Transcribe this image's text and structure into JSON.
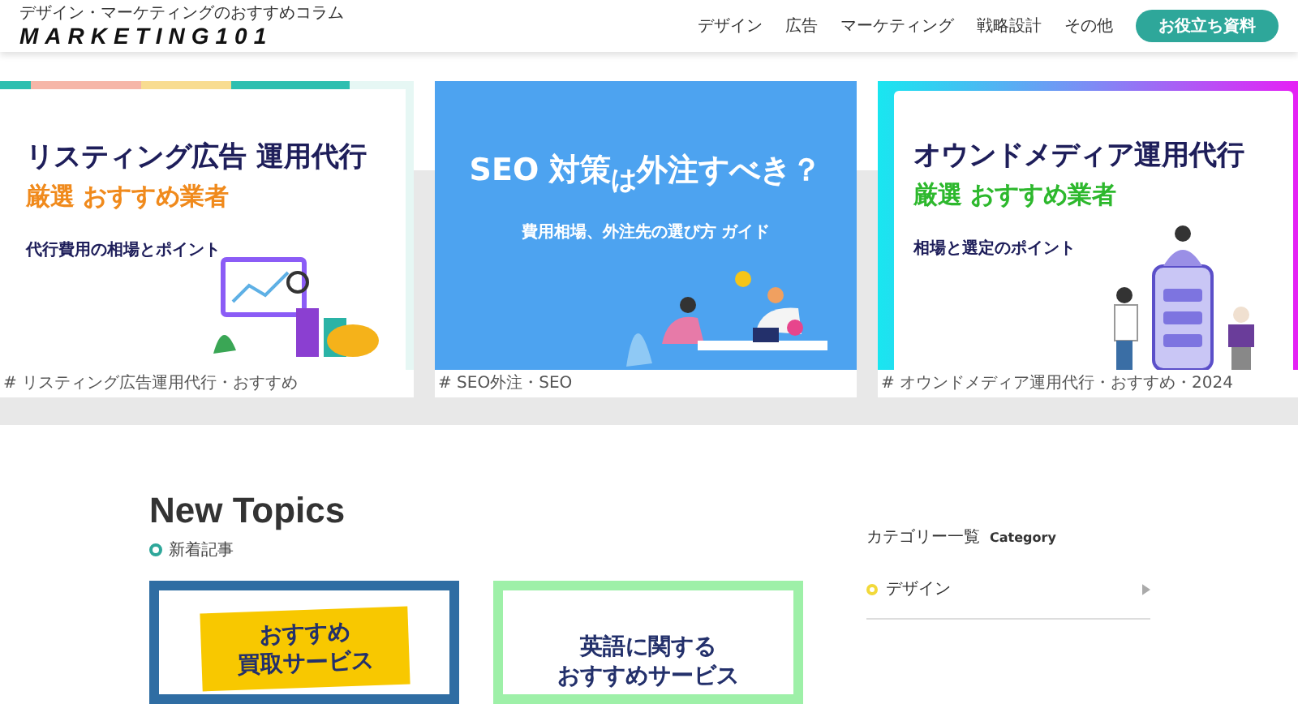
{
  "header": {
    "tagline": "デザイン・マーケティングのおすすめコラム",
    "logo": "MARKETING101",
    "nav": [
      "デザイン",
      "広告",
      "マーケティング",
      "戦略設計",
      "その他"
    ],
    "cta": "お役立ち資料"
  },
  "slides": [
    {
      "kind": "stripes",
      "title": "リスティング広告 運用代行",
      "subtitle": "厳選 おすすめ業者",
      "color": "#f08a1c",
      "note": "代行費用の相場とポイント",
      "tag": "# リスティング広告運用代行・おすすめ"
    },
    {
      "kind": "blue",
      "title": "SEO 対策$_{は}$外注すべき？",
      "subtitle": "費用相場、外注先の選び方 ガイド",
      "tag": "# SEO外注・SEO"
    },
    {
      "kind": "gradient",
      "title": "オウンドメディア運用代行",
      "subtitle": "厳選 おすすめ業者",
      "color": "#2db82d",
      "note": "相場と選定のポイント",
      "tag": "# オウンドメディア運用代行・おすすめ・2024"
    }
  ],
  "new_topics": {
    "heading": "New Topics",
    "subheading": "新着記事",
    "posts": [
      {
        "kind": "banner",
        "title_lines": [
          "おすすめ",
          "買取サービス"
        ],
        "color": "#2f6da3"
      },
      {
        "kind": "plain",
        "title_lines": [
          "英語に関する",
          "おすすめサービス"
        ],
        "color": "#9ef0a8"
      }
    ],
    "sidebar": {
      "heading": "カテゴリー一覧",
      "heading_en": "Category",
      "categories": [
        {
          "label": "デザイン",
          "color": "#f2d93a"
        }
      ]
    }
  }
}
